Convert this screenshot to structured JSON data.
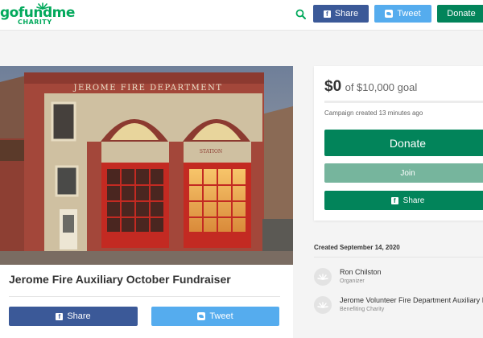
{
  "header": {
    "logo_word": "gofundme",
    "logo_sub": "CHARITY",
    "search_icon": "search-icon",
    "share_label": "Share",
    "tweet_label": "Tweet",
    "donate_label": "Donate"
  },
  "campaign": {
    "photo_sign": "JEROME FIRE DEPARTMENT",
    "photo_station": "STATION",
    "title": "Jerome Fire Auxiliary October Fundraiser",
    "share_label": "Share",
    "tweet_label": "Tweet"
  },
  "donation_panel": {
    "raised": "$0",
    "goal_text": "of $10,000 goal",
    "progress": 0,
    "created_text": "Campaign created 13 minutes ago",
    "donate_label": "Donate",
    "join_label": "Join",
    "share_label": "Share"
  },
  "organizers": {
    "created_date": "Created September 14, 2020",
    "people": [
      {
        "name": "Ron Chilston",
        "role": "Organizer"
      },
      {
        "name": "Jerome Volunteer Fire Department Auxiliary In",
        "role": "Benefiting Charity"
      }
    ]
  },
  "colors": {
    "brand_green": "#02a95c",
    "dark_green": "#02845a",
    "facebook_blue": "#3b5998",
    "twitter_blue": "#55acee",
    "join_green": "#76b59d"
  }
}
